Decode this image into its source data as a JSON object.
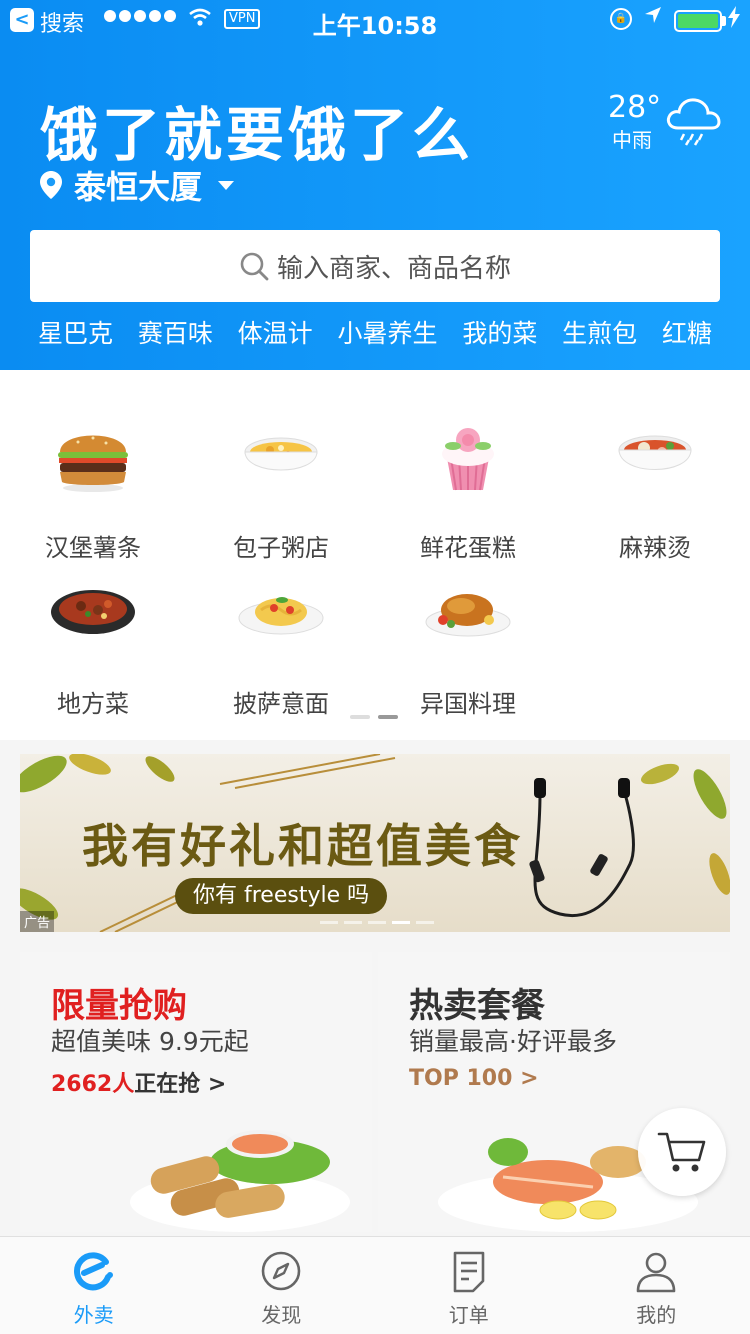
{
  "status_bar": {
    "back_app": "搜索",
    "network": "VPN",
    "time": "上午10:58"
  },
  "header": {
    "slogan": "饿了就要饿了么",
    "address": "泰恒大厦",
    "weather": {
      "temp": "28°",
      "desc": "中雨",
      "icon": "rain-cloud-icon"
    },
    "search_placeholder": "输入商家、商品名称",
    "hot_words": [
      "星巴克",
      "赛百味",
      "体温计",
      "小暑养生",
      "我的菜",
      "生煎包",
      "红糖"
    ]
  },
  "categories": [
    {
      "label": "汉堡薯条",
      "icon": "burger"
    },
    {
      "label": "包子粥店",
      "icon": "porridge"
    },
    {
      "label": "鲜花蛋糕",
      "icon": "cupcake"
    },
    {
      "label": "麻辣烫",
      "icon": "spicy-hotpot"
    },
    {
      "label": "地方菜",
      "icon": "local-dish"
    },
    {
      "label": "披萨意面",
      "icon": "pasta"
    },
    {
      "label": "异国料理",
      "icon": "roast-chicken"
    }
  ],
  "banner": {
    "title": "我有好礼和超值美食",
    "pill": "你有 freestyle 吗",
    "ad_label": "广告"
  },
  "promos": {
    "left": {
      "title": "限量抢购",
      "subtitle": "超值美味 9.9元起",
      "count": "2662人",
      "count_suffix": "正在抢 >"
    },
    "right": {
      "title": "热卖套餐",
      "subtitle": "销量最高·好评最多",
      "tag": "TOP 100 >"
    }
  },
  "tabbar": {
    "tabs": [
      {
        "label": "外卖",
        "icon": "eleme-logo-icon",
        "active": true
      },
      {
        "label": "发现",
        "icon": "compass-icon",
        "active": false
      },
      {
        "label": "订单",
        "icon": "order-icon",
        "active": false
      },
      {
        "label": "我的",
        "icon": "profile-icon",
        "active": false
      }
    ]
  },
  "colors": {
    "brand_blue": "#1a9bf8",
    "promo_red": "#e02020",
    "promo_brown": "#b07a4e"
  }
}
